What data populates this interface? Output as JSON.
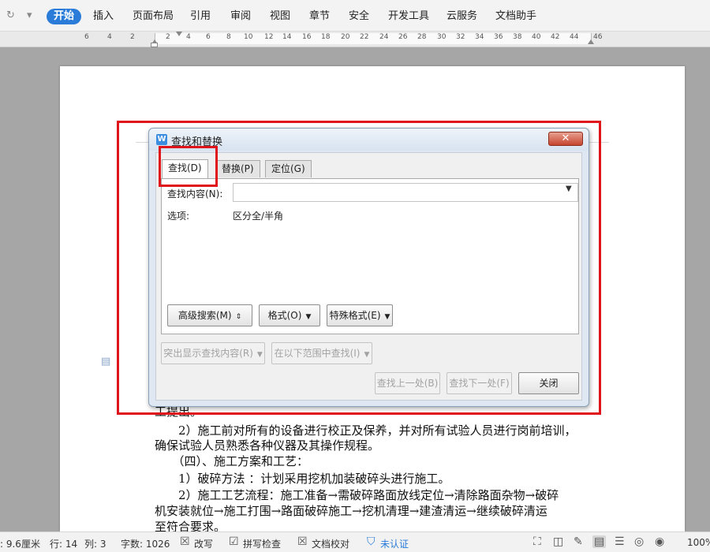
{
  "ribbon": {
    "tabs": [
      "开始",
      "插入",
      "页面布局",
      "引用",
      "审阅",
      "视图",
      "章节",
      "安全",
      "开发工具",
      "云服务",
      "文档助手"
    ],
    "active_tab": "开始"
  },
  "ruler": {
    "ticks": [
      "6",
      "4",
      "2",
      "2",
      "4",
      "6",
      "8",
      "10",
      "12",
      "14",
      "16",
      "18",
      "20",
      "22",
      "24",
      "26",
      "28",
      "30",
      "32",
      "34",
      "36",
      "38",
      "40",
      "42",
      "44",
      "46"
    ]
  },
  "document": {
    "paragraphs": [
      "工提出。",
      "　　2）施工前对所有的设备进行校正及保养，并对所有试验人员进行岗前培训，",
      "确保试验人员熟悉各种仪器及其操作规程。",
      "　　（四）、施工方案和工艺：",
      "　　1）破碎方法 ：计划采用挖机加装破碎头进行施工。",
      "　　2）施工工艺流程：施工准备→需破碎路面放线定位→清除路面杂物→破碎",
      "机安装就位→施工打围→路面破碎施工→挖机清理→建渣清运→继续破碎清运",
      "至符合要求。"
    ]
  },
  "dialog": {
    "app_icon_letter": "W",
    "title": "查找和替换",
    "close_glyph": "✕",
    "tabs": {
      "find": "查找(D)",
      "replace": "替换(P)",
      "goto": "定位(G)"
    },
    "find_label": "查找内容(N):",
    "find_value": "",
    "options_label": "选项:",
    "options_value": "区分全/半角",
    "buttons": {
      "advanced": "高级搜索(M)",
      "format": "格式(O)",
      "special": "特殊格式(E)",
      "highlight": "突出显示查找内容(R)",
      "find_in": "在以下范围中查找(I)",
      "prev": "查找上一处(B)",
      "next": "查找下一处(F)",
      "close": "关闭"
    }
  },
  "statusbar": {
    "position": ": 9.6厘米",
    "row": "行: 14",
    "col": "列: 3",
    "wordcount": "字数: 1026",
    "revise": "改写",
    "spellcheck": "拼写检查",
    "proofread": "文档校对",
    "auth": "未认证",
    "zoom": "100%"
  },
  "colors": {
    "accent": "#2b7cd9",
    "highlight_red": "#e0141b"
  }
}
